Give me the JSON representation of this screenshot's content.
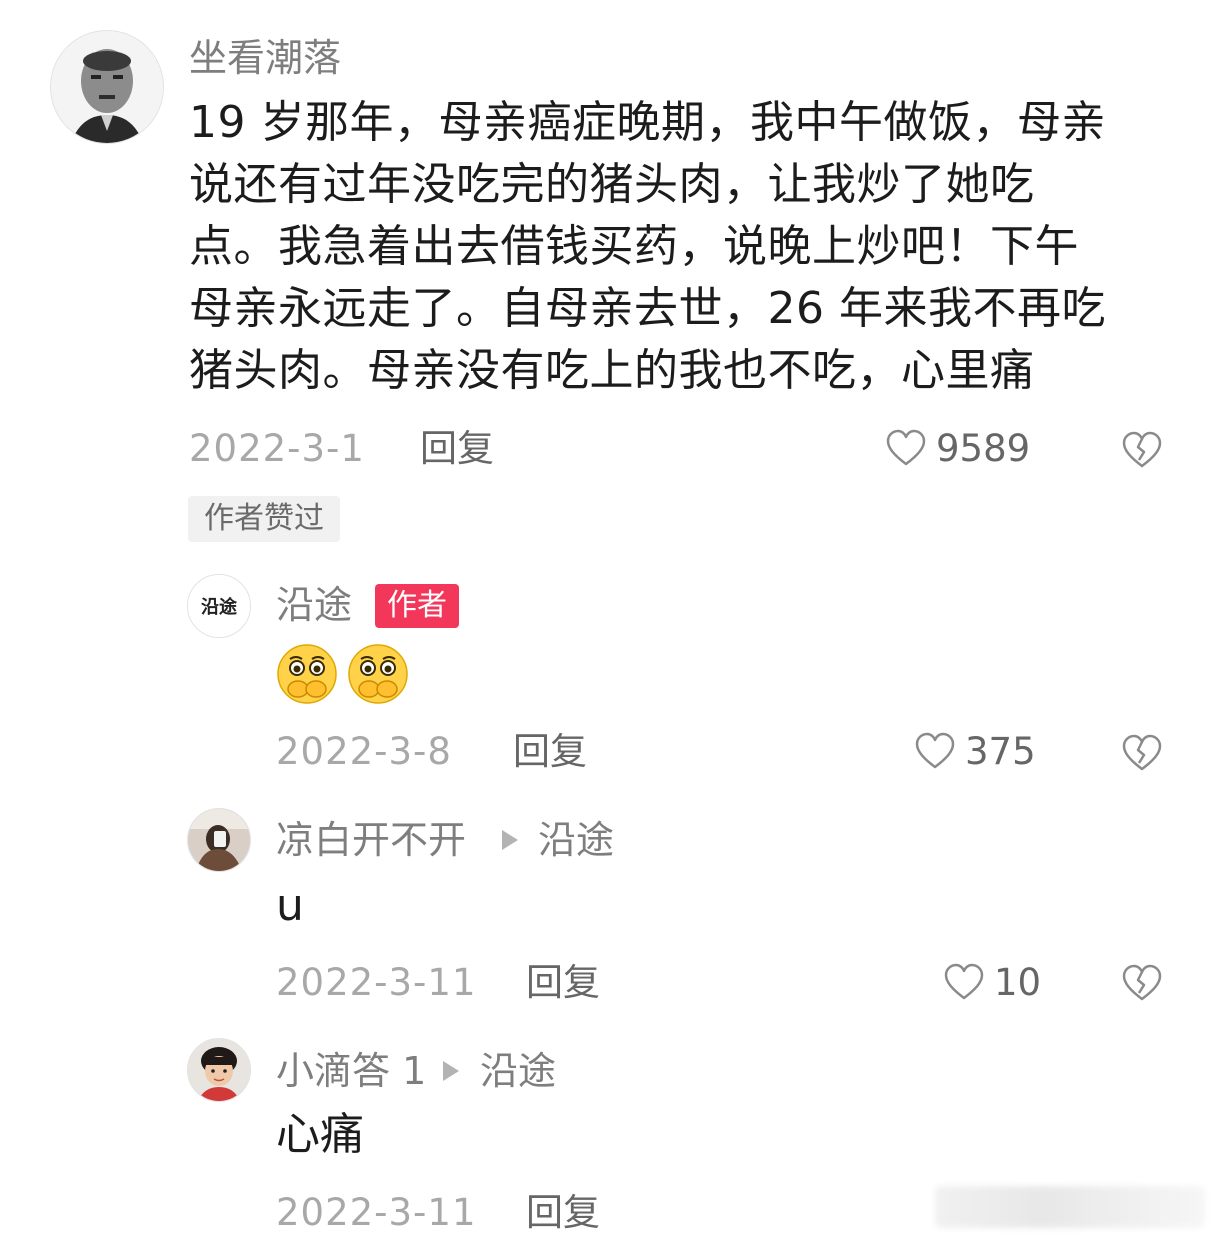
{
  "main_comment": {
    "username": "坐看潮落",
    "lines": [
      "19 岁那年，母亲癌症晚期，我中午做饭，母亲",
      "说还有过年没吃完的猪头肉，让我炒了她吃",
      "点。我急着出去借钱买药，说晚上炒吧！下午",
      "母亲永远走了。自母亲去世，26 年来我不再吃",
      "猪头肉。母亲没有吃上的我也不吃，心里痛"
    ],
    "date": "2022-3-1",
    "reply_label": "回复",
    "likes": "9589",
    "liked_by_author_tag": "作者赞过"
  },
  "replies": [
    {
      "username": "沿途",
      "avatar_text": "沿途",
      "badge": "作者",
      "emoji": [
        "face-holding-back-tears",
        "face-holding-back-tears"
      ],
      "date": "2022-3-8",
      "reply_label": "回复",
      "likes": "375"
    },
    {
      "username": "凉白开不开",
      "reply_to": "沿途",
      "text": "u",
      "date": "2022-3-11",
      "reply_label": "回复",
      "likes": "10"
    },
    {
      "username": "小滴答 1",
      "reply_to": "沿途",
      "text": "心痛",
      "date": "2022-3-11",
      "reply_label": "回复"
    }
  ],
  "colors": {
    "badge": "#f2375b",
    "username": "#7e7e7e",
    "date": "#a8a8a8",
    "text": "#1c1c1c"
  },
  "icons": {
    "like": "heart-outline-icon",
    "dislike": "broken-heart-icon",
    "reply_arrow": "play-triangle-icon"
  }
}
